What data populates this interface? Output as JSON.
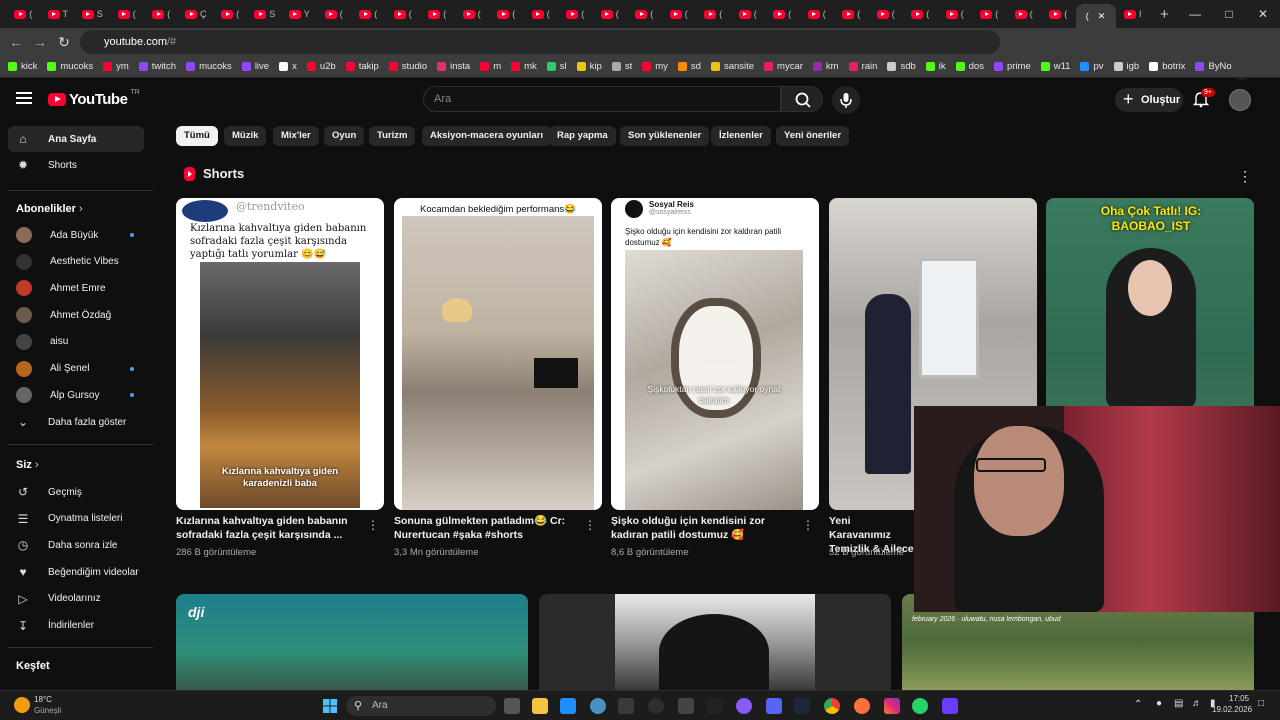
{
  "browser": {
    "tab_letters": [
      "(",
      "T",
      "S",
      "(",
      "(",
      "Ç",
      "(",
      "S",
      "Y",
      "(",
      "(",
      "(",
      "(",
      "(",
      "(",
      "(",
      "(",
      "(",
      "(",
      "(",
      "(",
      "(",
      "(",
      "(",
      "(",
      "(",
      "(",
      "(",
      "(",
      "(",
      "("
    ],
    "active_tab_letter": "(",
    "extra_tab_letter": "I",
    "url_site": "youtube.com",
    "url_path": "/#",
    "bookmarks": [
      {
        "label": "kick",
        "color": "#53fc18"
      },
      {
        "label": "mucoks",
        "color": "#53fc18"
      },
      {
        "label": "ym",
        "color": "#ff0033"
      },
      {
        "label": "twitch",
        "color": "#9146ff"
      },
      {
        "label": "mucoks",
        "color": "#9146ff"
      },
      {
        "label": "live",
        "color": "#9146ff"
      },
      {
        "label": "x",
        "color": "#ffffff"
      },
      {
        "label": "u2b",
        "color": "#ff0033"
      },
      {
        "label": "takip",
        "color": "#ff0033"
      },
      {
        "label": "studio",
        "color": "#ff0033"
      },
      {
        "label": "insta",
        "color": "#e1306c"
      },
      {
        "label": "m",
        "color": "#ff0033"
      },
      {
        "label": "mk",
        "color": "#ff0033"
      },
      {
        "label": "sl",
        "color": "#2ecc71"
      },
      {
        "label": "kip",
        "color": "#f1c40f"
      },
      {
        "label": "st",
        "color": "#aaaaaa"
      },
      {
        "label": "my",
        "color": "#ff0033"
      },
      {
        "label": "sd",
        "color": "#ff8c00"
      },
      {
        "label": "sansite",
        "color": "#f1c40f"
      },
      {
        "label": "mycar",
        "color": "#e91e63"
      },
      {
        "label": "km",
        "color": "#9c27b0"
      },
      {
        "label": "rain",
        "color": "#e91e63"
      },
      {
        "label": "sdb",
        "color": "#cccccc"
      },
      {
        "label": "ik",
        "color": "#53fc18"
      },
      {
        "label": "dos",
        "color": "#53fc18"
      },
      {
        "label": "prime",
        "color": "#9146ff"
      },
      {
        "label": "w11",
        "color": "#53fc18"
      },
      {
        "label": "pv",
        "color": "#1e90ff"
      },
      {
        "label": "igb",
        "color": "#cccccc"
      },
      {
        "label": "botrix",
        "color": "#ffffff"
      },
      {
        "label": "ByNo",
        "color": "#9146ff"
      }
    ]
  },
  "youtube": {
    "logo_text": "YouTube",
    "logo_region": "TR",
    "search_placeholder": "Ara",
    "create_label": "Oluştur",
    "notif_badge": "9+",
    "sidebar": {
      "home": "Ana Sayfa",
      "shorts": "Shorts",
      "subs_header": "Abonelikler",
      "subscriptions": [
        {
          "name": "Ada Büyük",
          "color": "#8a6a5a",
          "new": true
        },
        {
          "name": "Aesthetic Vibes",
          "color": "#333333",
          "new": false
        },
        {
          "name": "Ahmet Emre",
          "color": "#c0392b",
          "new": false
        },
        {
          "name": "Ahmet Özdağ",
          "color": "#6b5b4b",
          "new": false
        },
        {
          "name": "aisu",
          "color": "#444444",
          "new": false
        },
        {
          "name": "Ali Şenel",
          "color": "#b5651d",
          "new": true
        },
        {
          "name": "Alp Gursoy",
          "color": "#666666",
          "new": true
        }
      ],
      "show_more": "Daha fazla göster",
      "you_header": "Siz",
      "you_items": [
        "Geçmiş",
        "Oynatma listeleri",
        "Daha sonra izle",
        "Beğendiğim videolar",
        "Videolarınız",
        "İndirilenler"
      ],
      "explore_header": "Keşfet"
    },
    "chips": [
      "Tümü",
      "Müzik",
      "Mix'ler",
      "Oyun",
      "Turizm",
      "Aksiyon-macera oyunları",
      "Rap yapma",
      "Son yüklenenler",
      "İzlenenler",
      "Yeni öneriler"
    ],
    "shorts_title": "Shorts",
    "shorts": [
      {
        "title": "Kızlarına kahvaltıya giden babanın sofradaki fazla çeşit karşısında ...",
        "views": "286 B görüntüleme",
        "overlay_top": "@trendviteo",
        "overlay_caption": "Kızlarına kahvaltıya giden babanın sofradaki fazla çeşit karşısında yaptığı tatlı yorumlar 😊😅",
        "overlay_bottom": "Kızlarına kahvaltıya giden karadenizli baba"
      },
      {
        "title": "Sonuna gülmekten patladım😂 Cr: Nurertucan #şaka #shorts",
        "views": "3,3 Mn görüntüleme",
        "overlay_caption": "Kocamdan beklediğim performans😂"
      },
      {
        "title": "Şişko olduğu için kendisini zor kadıran patili dostumuz 🥰",
        "views": "8,6 B görüntüleme",
        "overlay_channel": "Sosyal Reis",
        "overlay_handle": "@sosyalreiss",
        "overlay_caption": "Şişko olduğu için kendisini zor kaldıran patili dostumuz 🥰",
        "overlay_bottom": "Şişkoluktan nasıl zor kalkıyor oynat bakalım",
        "overlay_watermark": "@sosyalreis"
      },
      {
        "title": "Yeni Karavanımız Temizlik & Ailece",
        "views": "52 B görüntüleme"
      },
      {
        "overlay_caption": "Oha Çok Tatlı! IG: BAOBAO_IST"
      }
    ],
    "row2": [
      {
        "overlay": "dji"
      },
      {
        "overlay": ""
      },
      {
        "overlay": "february 2026 · uluwatu, nusa lembongan, ubud"
      }
    ]
  },
  "taskbar": {
    "weather_temp": "18°C",
    "weather_desc": "Güneşli",
    "search_placeholder": "Ara",
    "time": "17:05",
    "date": "19.02.2026"
  }
}
